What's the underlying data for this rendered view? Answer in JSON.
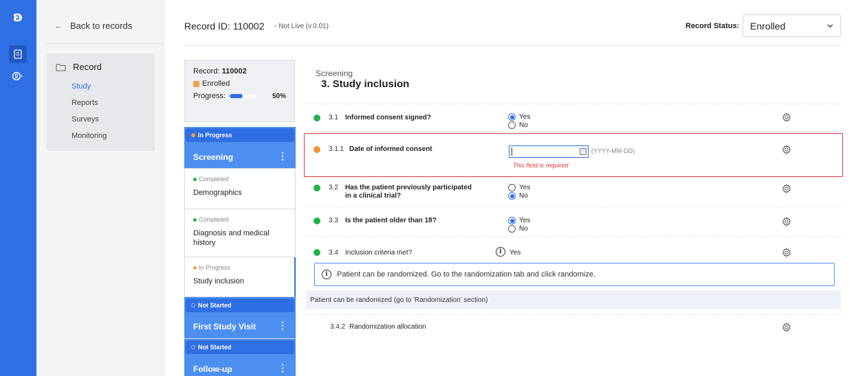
{
  "rail": {
    "logo_icon": "castor-logo",
    "icons": [
      "records-icon",
      "user-menu-icon"
    ]
  },
  "sidebar": {
    "back_label": "Back to records",
    "menu_title": "Record",
    "items": [
      {
        "label": "Study",
        "active": true
      },
      {
        "label": "Reports",
        "active": false
      },
      {
        "label": "Surveys",
        "active": false
      },
      {
        "label": "Monitoring",
        "active": false
      }
    ]
  },
  "header": {
    "record_id_label": "Record ID: 110002",
    "live_status": "◦ Not Live (v.0.01)",
    "record_status_label": "Record Status:",
    "record_status_value": "Enrolled"
  },
  "record_card": {
    "record_label": "Record:",
    "record_value": "110002",
    "status": "Enrolled",
    "progress_label": "Progress:",
    "progress_percent": 50,
    "progress_text": "50%"
  },
  "steps": [
    {
      "type": "phase",
      "status": "In Progress",
      "title": "Screening",
      "status_color": "#f3a04a"
    },
    {
      "type": "form",
      "status": "Completed",
      "title": "Demographics",
      "status_color": "#22b14c"
    },
    {
      "type": "form",
      "status": "Completed",
      "title": "Diagnosis and medical history",
      "status_color": "#22b14c"
    },
    {
      "type": "form",
      "status": "In Progress",
      "title": "Study inclusion",
      "status_color": "#f3a04a"
    },
    {
      "type": "phase",
      "status": "Not Started",
      "title": "First Study Visit",
      "status_color": "#ffffff"
    },
    {
      "type": "phase",
      "status": "Not Started",
      "title": "Follow-up",
      "status_color": "#ffffff"
    }
  ],
  "form": {
    "section": "Screening",
    "title": "3. Study inclusion",
    "questions": [
      {
        "num": "3.1",
        "text": "Informed consent signed?",
        "options": [
          "Yes",
          "No"
        ],
        "selected": "Yes",
        "dot": "#22b14c"
      },
      {
        "num": "3.1.1",
        "text": "Date of informed consent",
        "date_format": "(YYYY-MM-DD)",
        "error": "This field is required",
        "dot": "#f39231"
      },
      {
        "num": "3.2",
        "text": "Has the patient previously participated in a clinical trial?",
        "options": [
          "Yes",
          "No"
        ],
        "selected": "No",
        "dot": "#22b14c"
      },
      {
        "num": "3.3",
        "text": "Is the patient older than 18?",
        "options": [
          "Yes",
          "No"
        ],
        "selected": "Yes",
        "dot": "#22b14c"
      },
      {
        "num": "3.4",
        "text": "Inclusion criteria met?",
        "value": "Yes",
        "dot": "#22b14c"
      }
    ],
    "banner_text": "Patient can be randomized. Go to the randomization tab and click randomize.",
    "info_text": "Patient can be randomized (go to 'Randomization' section)",
    "randomization": {
      "num": "3.4.2",
      "text": "Randomization allocation"
    }
  }
}
